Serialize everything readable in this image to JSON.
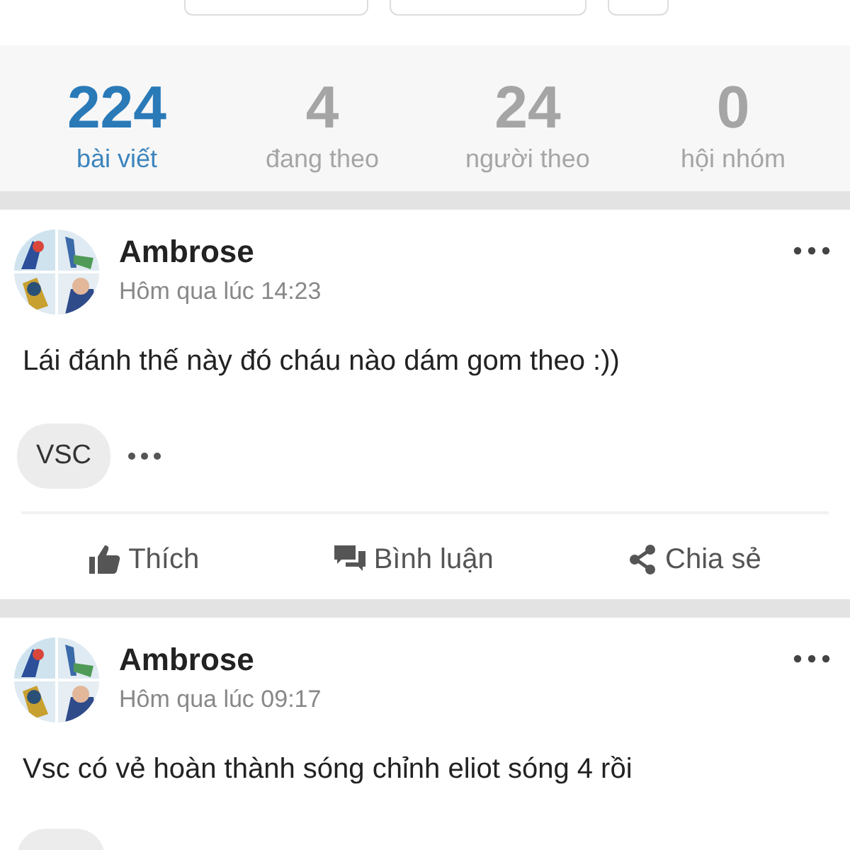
{
  "stats": [
    {
      "count": "224",
      "label": "bài viết",
      "selected": true
    },
    {
      "count": "4",
      "label": "đang theo",
      "selected": false
    },
    {
      "count": "24",
      "label": "người theo",
      "selected": false
    },
    {
      "count": "0",
      "label": "hội nhóm",
      "selected": false
    }
  ],
  "posts": [
    {
      "author": "Ambrose",
      "time": "Hôm qua lúc 14:23",
      "text": "Lái đánh thế này đó cháu nào dám gom theo :))",
      "tags": [
        "VSC"
      ],
      "actions": [
        {
          "kind": "like",
          "label": "Thích"
        },
        {
          "kind": "comment",
          "label": "Bình luận"
        },
        {
          "kind": "share",
          "label": "Chia sẻ"
        }
      ]
    },
    {
      "author": "Ambrose",
      "time": "Hôm qua lúc 09:17",
      "text": "Vsc có vẻ hoàn thành sóng chỉnh eliot sóng 4 rồi"
    }
  ]
}
